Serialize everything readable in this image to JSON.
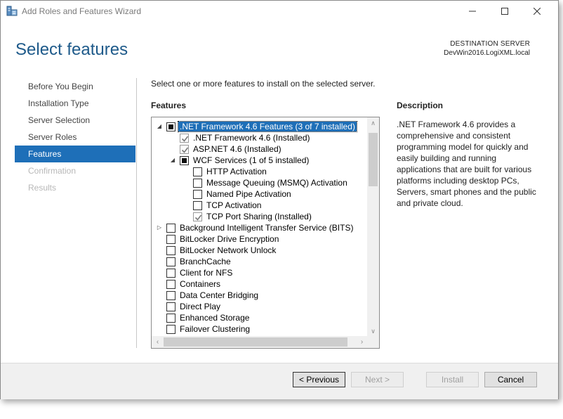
{
  "window": {
    "title": "Add Roles and Features Wizard"
  },
  "header": {
    "page_title": "Select features",
    "destination_label": "DESTINATION SERVER",
    "destination_server": "DevWin2016.LogiXML.local"
  },
  "nav": {
    "items": [
      {
        "label": "Before You Begin",
        "state": "normal"
      },
      {
        "label": "Installation Type",
        "state": "normal"
      },
      {
        "label": "Server Selection",
        "state": "normal"
      },
      {
        "label": "Server Roles",
        "state": "normal"
      },
      {
        "label": "Features",
        "state": "active"
      },
      {
        "label": "Confirmation",
        "state": "disabled"
      },
      {
        "label": "Results",
        "state": "disabled"
      }
    ]
  },
  "main": {
    "instruction": "Select one or more features to install on the selected server.",
    "features_label": "Features",
    "features": [
      {
        "label": ".NET Framework 4.6 Features (3 of 7 installed)",
        "level": 0,
        "expander": "expanded",
        "check": "partial",
        "selected": true
      },
      {
        "label": ".NET Framework 4.6 (Installed)",
        "level": 1,
        "expander": "none",
        "check": "checked-disabled",
        "selected": false
      },
      {
        "label": "ASP.NET 4.6 (Installed)",
        "level": 1,
        "expander": "none",
        "check": "checked-disabled",
        "selected": false
      },
      {
        "label": "WCF Services (1 of 5 installed)",
        "level": 1,
        "expander": "expanded",
        "check": "partial",
        "selected": false
      },
      {
        "label": "HTTP Activation",
        "level": 2,
        "expander": "none",
        "check": "unchecked",
        "selected": false
      },
      {
        "label": "Message Queuing (MSMQ) Activation",
        "level": 2,
        "expander": "none",
        "check": "unchecked",
        "selected": false
      },
      {
        "label": "Named Pipe Activation",
        "level": 2,
        "expander": "none",
        "check": "unchecked",
        "selected": false
      },
      {
        "label": "TCP Activation",
        "level": 2,
        "expander": "none",
        "check": "unchecked",
        "selected": false
      },
      {
        "label": "TCP Port Sharing (Installed)",
        "level": 2,
        "expander": "none",
        "check": "checked-disabled",
        "selected": false
      },
      {
        "label": "Background Intelligent Transfer Service (BITS)",
        "level": 0,
        "expander": "collapsed",
        "check": "unchecked",
        "selected": false
      },
      {
        "label": "BitLocker Drive Encryption",
        "level": 0,
        "expander": "none",
        "check": "unchecked",
        "selected": false
      },
      {
        "label": "BitLocker Network Unlock",
        "level": 0,
        "expander": "none",
        "check": "unchecked",
        "selected": false
      },
      {
        "label": "BranchCache",
        "level": 0,
        "expander": "none",
        "check": "unchecked",
        "selected": false
      },
      {
        "label": "Client for NFS",
        "level": 0,
        "expander": "none",
        "check": "unchecked",
        "selected": false
      },
      {
        "label": "Containers",
        "level": 0,
        "expander": "none",
        "check": "unchecked",
        "selected": false
      },
      {
        "label": "Data Center Bridging",
        "level": 0,
        "expander": "none",
        "check": "unchecked",
        "selected": false
      },
      {
        "label": "Direct Play",
        "level": 0,
        "expander": "none",
        "check": "unchecked",
        "selected": false
      },
      {
        "label": "Enhanced Storage",
        "level": 0,
        "expander": "none",
        "check": "unchecked",
        "selected": false
      },
      {
        "label": "Failover Clustering",
        "level": 0,
        "expander": "none",
        "check": "unchecked",
        "selected": false
      }
    ]
  },
  "description": {
    "label": "Description",
    "text": ".NET Framework 4.6 provides a comprehensive and consistent programming model for quickly and easily building and running applications that are built for various platforms including desktop PCs, Servers, smart phones and the public and private cloud."
  },
  "footer": {
    "previous_label": "< Previous",
    "next_label": "Next >",
    "install_label": "Install",
    "cancel_label": "Cancel"
  },
  "colors": {
    "accent": "#1e6fb8",
    "title_blue": "#1e5a8a",
    "footer_bg": "#f0f0f0"
  },
  "icons": {
    "app": "server-manager-icon",
    "minimize": "minimize-icon",
    "maximize": "maximize-icon",
    "close": "close-icon"
  }
}
